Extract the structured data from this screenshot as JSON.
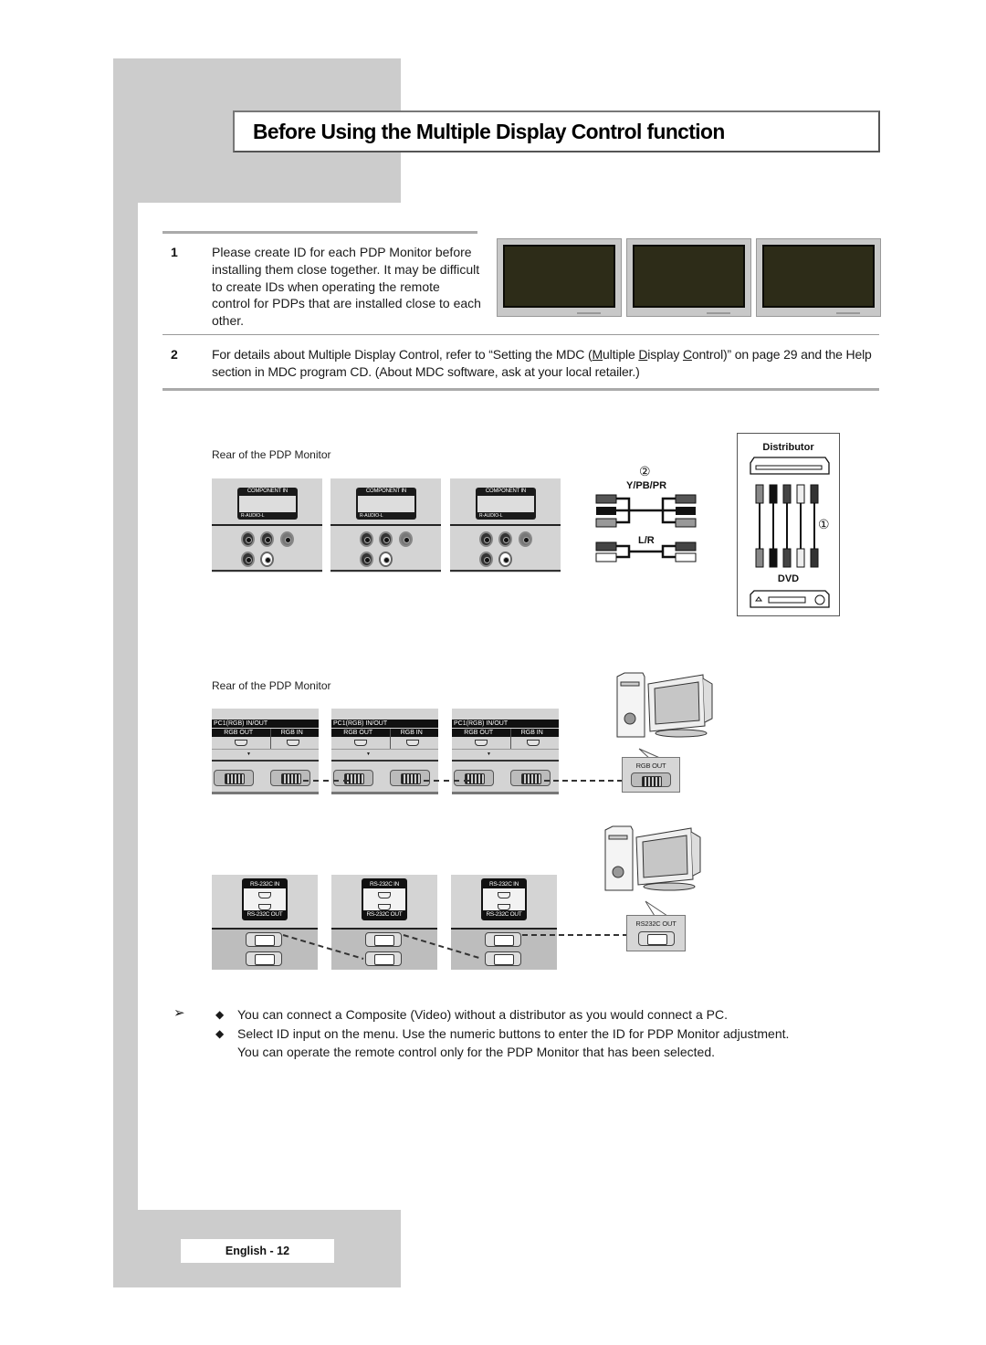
{
  "header": {
    "title": "Before Using the Multiple Display Control function"
  },
  "steps": [
    {
      "number": "1",
      "text": "Please create ID for each PDP Monitor before installing them close together. It may be difficult to create IDs when operating the remote control for PDPs that are installed close to each other."
    },
    {
      "number": "2",
      "text_parts": {
        "before": "For details about Multiple Display Control, refer to “Setting the MDC (",
        "m": "M",
        "ultiple": "ultiple ",
        "d": "D",
        "isplay": "isplay ",
        "c": "C",
        "ontrol": "ontrol)” on page 29 and the Help section in MDC program CD. (About MDC software, ask at your local retailer.)"
      }
    }
  ],
  "illustrations": {
    "pdp_monitor_count": 3,
    "component_section": {
      "caption": "Rear of the PDP Monitor",
      "panel_header": "COMPONENT IN",
      "panel_footer": "R-AUDIO-L",
      "cable_circle_2": "②",
      "cable_label_video": "Y/PB/PR",
      "cable_label_audio": "L/R",
      "cable_circle_1": "①",
      "distributor_label": "Distributor",
      "dvd_label": "DVD"
    },
    "rgb_section": {
      "caption": "Rear of the PDP Monitor",
      "panel_header": "PC1(RGB) IN/OUT",
      "port_out": "RGB OUT",
      "port_in": "RGB IN",
      "pc_connector_label": "RGB OUT"
    },
    "rs232_section": {
      "label_in": "RS-232C IN",
      "label_out": "RS-232C OUT",
      "pc_connector_label": "RS232C OUT"
    }
  },
  "notes": {
    "arrow_glyph": "➢",
    "bullet_glyph": "◆",
    "items": [
      "You can connect a Composite (Video) without a distributor as you would connect a PC.",
      "Select ID input on the menu. Use the numeric buttons to enter the ID for PDP Monitor adjustment. You can operate the remote control only for the PDP Monitor that has been selected."
    ]
  },
  "footer": {
    "page_label": "English - 12"
  }
}
